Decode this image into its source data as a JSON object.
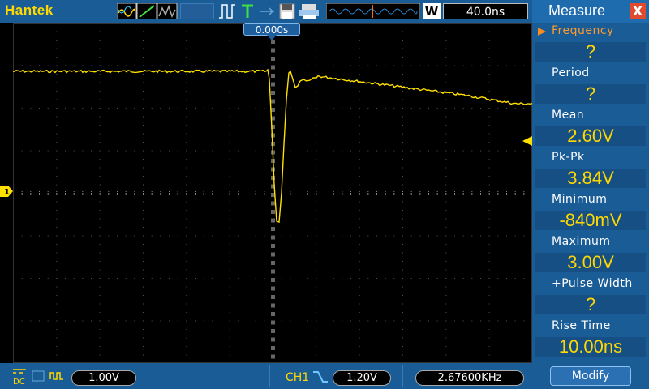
{
  "header": {
    "brand": "Hantek",
    "run_mode_badge": "W",
    "timebase": "40.0ns"
  },
  "screen": {
    "trigger_position": "0.000s",
    "channel_marker": "1"
  },
  "footer": {
    "coupling": "DC",
    "ch1_volts_div": "1.00V",
    "trigger_channel": "CH1",
    "trigger_level": "1.20V",
    "frequency_counter": "2.67600KHz"
  },
  "measure": {
    "title": "Measure",
    "close_label": "X",
    "rows": [
      {
        "label": "Frequency",
        "value": "?"
      },
      {
        "label": "Period",
        "value": "?"
      },
      {
        "label": "Mean",
        "value": "2.60V"
      },
      {
        "label": "Pk-Pk",
        "value": "3.84V"
      },
      {
        "label": "Minimum",
        "value": "-840mV"
      },
      {
        "label": "Maximum",
        "value": "3.00V"
      },
      {
        "label": "+Pulse Width",
        "value": "?"
      },
      {
        "label": "Rise Time",
        "value": "10.00ns"
      }
    ],
    "modify_label": "Modify"
  },
  "colors": {
    "trace": "#ffe000",
    "panel": "#1a5c96",
    "accent": "#ffd800"
  }
}
